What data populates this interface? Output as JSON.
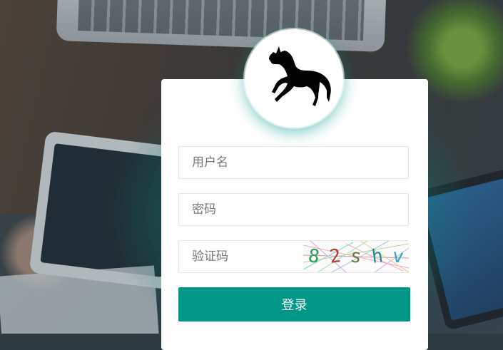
{
  "form": {
    "username_placeholder": "用户名",
    "password_placeholder": "密码",
    "captcha_placeholder": "验证码",
    "captcha_text": "82shv",
    "login_label": "登录"
  },
  "icons": {
    "logo": "horse-icon"
  },
  "colors": {
    "primary": "#009688",
    "card_bg": "#ffffff",
    "border": "#e6e6e6"
  }
}
